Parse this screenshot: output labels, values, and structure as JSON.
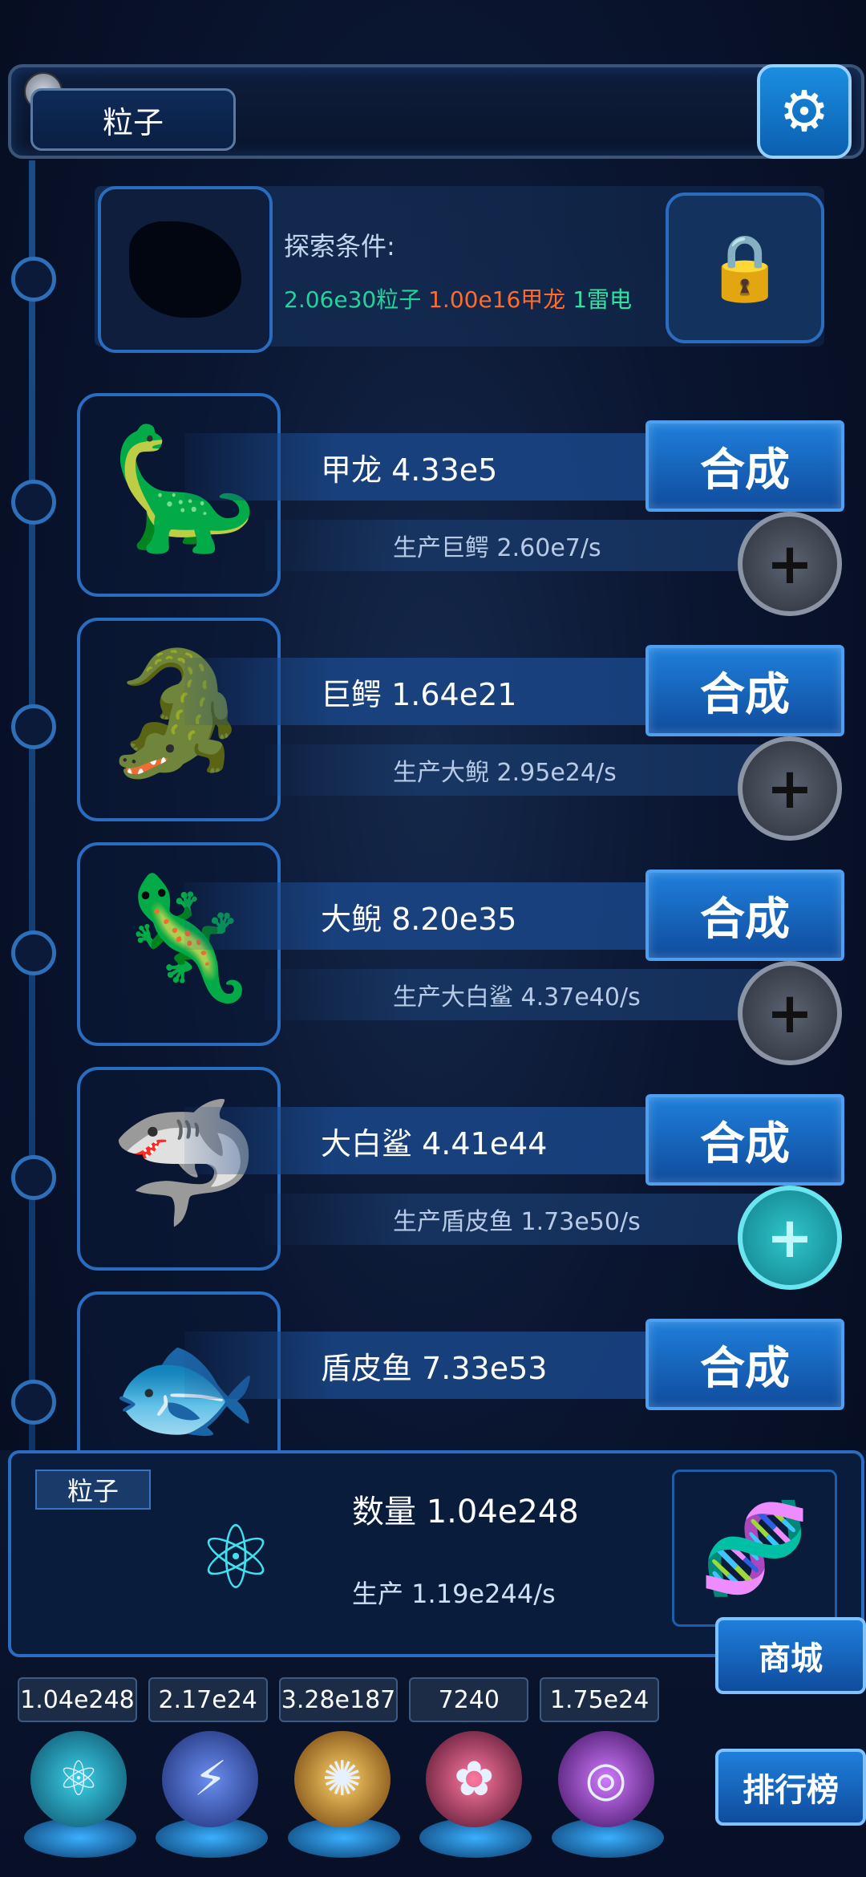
{
  "header": {
    "title": "粒子",
    "settings_icon": "gear-icon"
  },
  "locked": {
    "label": "探索条件:",
    "req_particles": "2.06e30粒子",
    "req_jialong": "1.00e16甲龙",
    "req_thunder": "1雷电"
  },
  "creatures": [
    {
      "name": "甲龙 4.33e5",
      "prod": "生产巨鳄 2.60e7/s",
      "compose": "合成",
      "icon": "ankylosaur-icon"
    },
    {
      "name": "巨鳄 1.64e21",
      "prod": "生产大鲵 2.95e24/s",
      "compose": "合成",
      "icon": "crocodile-icon"
    },
    {
      "name": "大鲵 8.20e35",
      "prod": "生产大白鲨 4.37e40/s",
      "compose": "合成",
      "icon": "axolotl-icon"
    },
    {
      "name": "大白鲨 4.41e44",
      "prod": "生产盾皮鱼 1.73e50/s",
      "compose": "合成",
      "icon": "shark-icon"
    },
    {
      "name": "盾皮鱼 7.33e53",
      "prod": "",
      "compose": "合成",
      "icon": "placoderm-icon"
    }
  ],
  "resource": {
    "tag": "粒子",
    "count": "数量 1.04e248",
    "production": "生产 1.19e244/s"
  },
  "counters": [
    "1.04e248",
    "2.17e24",
    "3.28e187",
    "7240",
    "1.75e24"
  ],
  "side": {
    "shop": "商城",
    "rank": "排行榜"
  }
}
